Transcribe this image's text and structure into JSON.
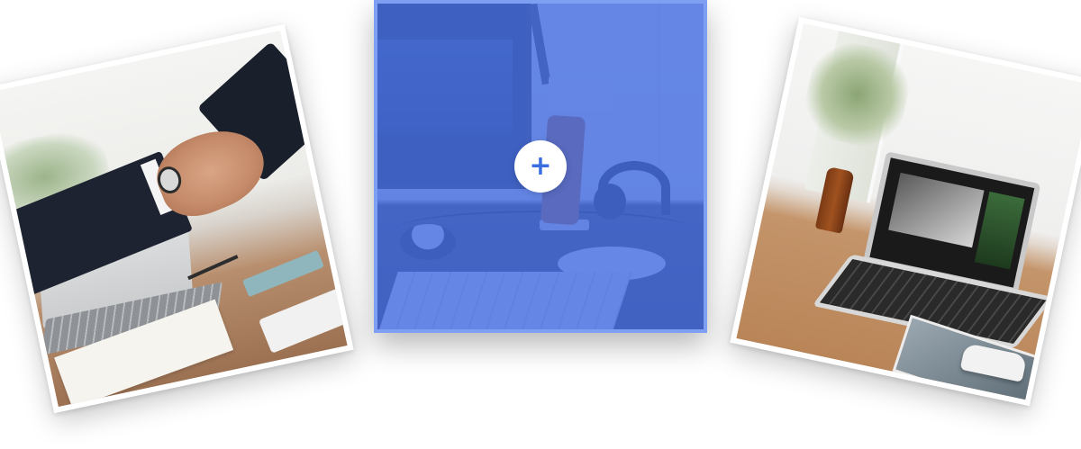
{
  "gallery": {
    "photos": [
      {
        "subject": "handshake",
        "overlay": false
      },
      {
        "subject": "desk-setup",
        "overlay": true
      },
      {
        "subject": "laptop-on-desk",
        "overlay": false
      }
    ],
    "center": {
      "plus_label": "+",
      "overlay_color": "#466ee1",
      "icon": "plus-icon"
    }
  }
}
